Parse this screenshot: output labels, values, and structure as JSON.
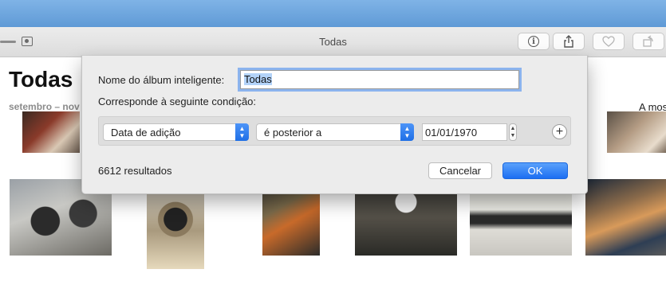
{
  "window": {
    "title": "Todas",
    "toolbar_buttons": [
      {
        "name": "info",
        "icon": "info-icon"
      },
      {
        "name": "share",
        "icon": "share-icon"
      },
      {
        "name": "favorite",
        "icon": "heart-icon"
      },
      {
        "name": "rotate",
        "icon": "rotate-icon"
      }
    ]
  },
  "library": {
    "title": "Todas",
    "date_range": "setembro – nov",
    "show_more": "A mos"
  },
  "dialog": {
    "name_label": "Nome do álbum inteligente:",
    "name_value": "Todas",
    "match_label": "Corresponde à seguinte condição:",
    "rule": {
      "field": "Data de adição",
      "operator": "é posterior a",
      "value": "01/01/1970"
    },
    "result_count": "6612 resultados",
    "cancel_label": "Cancelar",
    "ok_label": "OK"
  },
  "colors": {
    "accent": "#1c6ef2",
    "focus_ring": "#8cb4ee",
    "selection": "#b3d3f9"
  }
}
